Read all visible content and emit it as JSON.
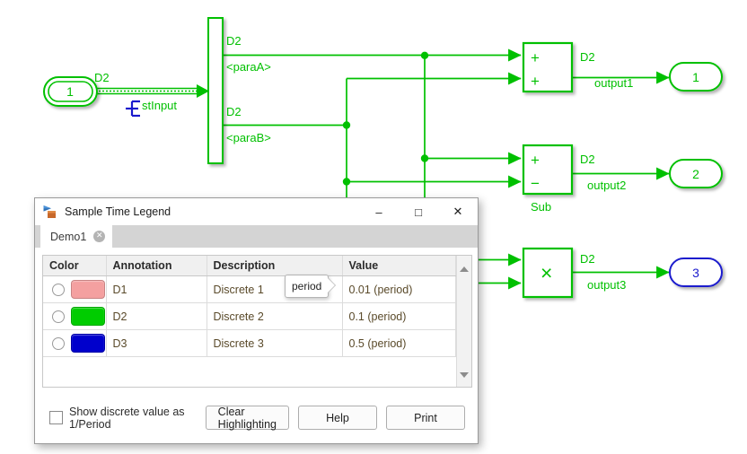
{
  "diagram": {
    "input_port": {
      "number": "1",
      "signal_label": "D2",
      "annotation": "stInput",
      "annotation_icon": "signal-port-icon"
    },
    "bus_selector": {
      "name": "bus-selector",
      "outputs": [
        {
          "signal_label": "D2",
          "bus_element": "<paraA>"
        },
        {
          "signal_label": "D2",
          "bus_element": "<paraB>"
        }
      ]
    },
    "blocks": [
      {
        "id": "sum-add",
        "type": "sum",
        "signs": [
          "+",
          "+"
        ],
        "caption": "",
        "out_signal": "D2",
        "out_name": "output1"
      },
      {
        "id": "sum-sub",
        "type": "sum",
        "signs": [
          "+",
          "−"
        ],
        "caption": "Sub",
        "out_signal": "D2",
        "out_name": "output2"
      },
      {
        "id": "product",
        "type": "product",
        "glyph": "×",
        "caption": "",
        "out_signal": "D2",
        "out_name": "output3"
      }
    ],
    "output_ports": [
      {
        "number": "1",
        "color": "#00c000"
      },
      {
        "number": "2",
        "color": "#00c000"
      },
      {
        "number": "3",
        "color": "#1a1acd"
      }
    ],
    "signal_color": "#00c000"
  },
  "dialog": {
    "title": "Sample Time Legend",
    "app_icon": "simulink-icon",
    "window_controls": {
      "minimize": "–",
      "maximize": "□",
      "close": "✕"
    },
    "tab": {
      "label": "Demo1",
      "close": "✕"
    },
    "table": {
      "columns": [
        "Color",
        "Annotation",
        "Description",
        "Value"
      ],
      "rows": [
        {
          "color": "#f4a0a0",
          "annotation": "D1",
          "description": "Discrete 1",
          "value": "0.01 (period)"
        },
        {
          "color": "#00cc00",
          "annotation": "D2",
          "description": "Discrete 2",
          "value": "0.1 (period)"
        },
        {
          "color": "#0000cc",
          "annotation": "D3",
          "description": "Discrete 3",
          "value": "0.5 (period)"
        }
      ]
    },
    "tooltip": {
      "text": "period"
    },
    "footer": {
      "checkbox_label": "Show discrete value as 1/Period",
      "checkbox_checked": false,
      "buttons": [
        "Clear Highlighting",
        "Help",
        "Print"
      ]
    }
  }
}
